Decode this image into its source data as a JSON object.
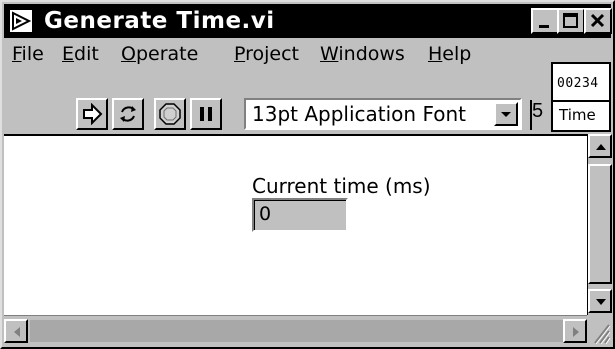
{
  "window": {
    "title": "Generate Time.vi",
    "colors": {
      "titlebar": "#000000",
      "face": "#c0c0c0",
      "panel": "#ffffff"
    }
  },
  "menu": {
    "items": [
      {
        "label": "File",
        "mnemonic": "F"
      },
      {
        "label": "Edit",
        "mnemonic": "E"
      },
      {
        "label": "Operate",
        "mnemonic": "O"
      },
      {
        "label": "Project",
        "mnemonic": "P"
      },
      {
        "label": "Windows",
        "mnemonic": "W"
      },
      {
        "label": "Help",
        "mnemonic": "H"
      }
    ]
  },
  "toolbar": {
    "run_icon": "run-arrow-icon",
    "run_continuous_icon": "run-continuously-icon",
    "abort_icon": "abort-stop-icon",
    "pause_icon": "pause-icon",
    "font_select_value": "13pt Application Font",
    "clipped_fragment": "5"
  },
  "vi_icon": {
    "top_text": "00234",
    "bottom_text": "Time"
  },
  "front_panel": {
    "control_label": "Current time (ms)",
    "control_value": "0"
  }
}
